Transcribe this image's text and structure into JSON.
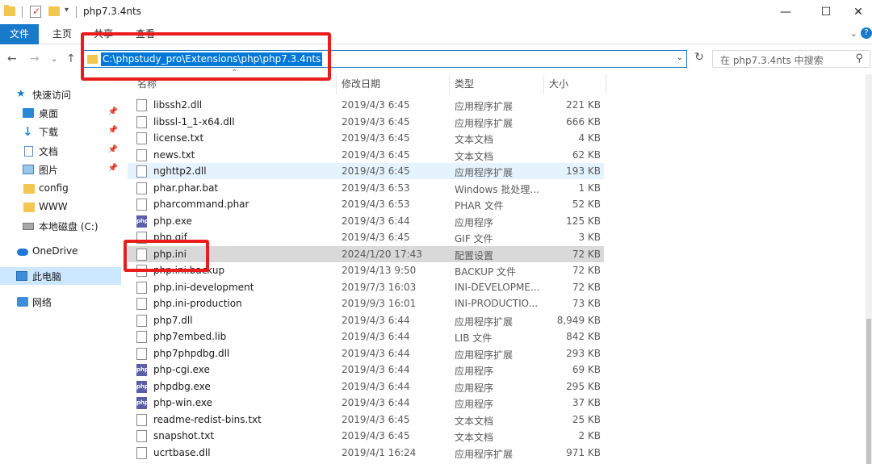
{
  "window": {
    "title": "php7.3.4nts",
    "quick_access_down": "▾"
  },
  "ribbon": {
    "tabs": [
      "文件",
      "主页",
      "共享",
      "查看"
    ]
  },
  "address": {
    "path": "C:\\phpstudy_pro\\Extensions\\php\\php7.3.4nts",
    "search_placeholder": "在 php7.3.4nts 中搜索"
  },
  "navpane": {
    "quick_access": "快速访问",
    "items": [
      {
        "label": "桌面",
        "icon": "desktop-icon",
        "pinned": true
      },
      {
        "label": "下载",
        "icon": "download-icon",
        "pinned": true
      },
      {
        "label": "文档",
        "icon": "document-icon",
        "pinned": true
      },
      {
        "label": "图片",
        "icon": "picture-icon",
        "pinned": true
      },
      {
        "label": "config",
        "icon": "folder-icon",
        "pinned": false
      },
      {
        "label": "WWW",
        "icon": "folder-icon",
        "pinned": false
      },
      {
        "label": "本地磁盘 (C:)",
        "icon": "drive-icon",
        "pinned": false
      }
    ],
    "onedrive": "OneDrive",
    "this_pc": "此电脑",
    "network": "网络"
  },
  "columns": {
    "name": "名称",
    "date": "修改日期",
    "type": "类型",
    "size": "大小"
  },
  "files": [
    {
      "name": "libssh2.dll",
      "date": "2019/4/3 6:45",
      "type": "应用程序扩展",
      "size": "221 KB",
      "icon": "dll"
    },
    {
      "name": "libssl-1_1-x64.dll",
      "date": "2019/4/3 6:45",
      "type": "应用程序扩展",
      "size": "666 KB",
      "icon": "dll"
    },
    {
      "name": "license.txt",
      "date": "2019/4/3 6:45",
      "type": "文本文档",
      "size": "4 KB",
      "icon": "txt"
    },
    {
      "name": "news.txt",
      "date": "2019/4/3 6:45",
      "type": "文本文档",
      "size": "62 KB",
      "icon": "txt"
    },
    {
      "name": "nghttp2.dll",
      "date": "2019/4/3 6:45",
      "type": "应用程序扩展",
      "size": "193 KB",
      "icon": "dll"
    },
    {
      "name": "phar.phar.bat",
      "date": "2019/4/3 6:53",
      "type": "Windows 批处理...",
      "size": "1 KB",
      "icon": "bat"
    },
    {
      "name": "pharcommand.phar",
      "date": "2019/4/3 6:53",
      "type": "PHAR 文件",
      "size": "52 KB",
      "icon": "file"
    },
    {
      "name": "php.exe",
      "date": "2019/4/3 6:44",
      "type": "应用程序",
      "size": "125 KB",
      "icon": "exe"
    },
    {
      "name": "php.gif",
      "date": "2019/4/3 6:45",
      "type": "GIF 文件",
      "size": "3 KB",
      "icon": "gif"
    },
    {
      "name": "php.ini",
      "date": "2024/1/20 17:43",
      "type": "配置设置",
      "size": "72 KB",
      "icon": "ini"
    },
    {
      "name": "php.ini.backup",
      "date": "2019/4/13 9:50",
      "type": "BACKUP 文件",
      "size": "72 KB",
      "icon": "file"
    },
    {
      "name": "php.ini-development",
      "date": "2019/7/3 16:03",
      "type": "INI-DEVELOPME...",
      "size": "72 KB",
      "icon": "file"
    },
    {
      "name": "php.ini-production",
      "date": "2019/9/3 16:01",
      "type": "INI-PRODUCTIO...",
      "size": "73 KB",
      "icon": "file"
    },
    {
      "name": "php7.dll",
      "date": "2019/4/3 6:44",
      "type": "应用程序扩展",
      "size": "8,949 KB",
      "icon": "dll"
    },
    {
      "name": "php7embed.lib",
      "date": "2019/4/3 6:44",
      "type": "LIB 文件",
      "size": "842 KB",
      "icon": "file"
    },
    {
      "name": "php7phpdbg.dll",
      "date": "2019/4/3 6:44",
      "type": "应用程序扩展",
      "size": "293 KB",
      "icon": "dll"
    },
    {
      "name": "php-cgi.exe",
      "date": "2019/4/3 6:44",
      "type": "应用程序",
      "size": "69 KB",
      "icon": "exe"
    },
    {
      "name": "phpdbg.exe",
      "date": "2019/4/3 6:44",
      "type": "应用程序",
      "size": "295 KB",
      "icon": "exe"
    },
    {
      "name": "php-win.exe",
      "date": "2019/4/3 6:44",
      "type": "应用程序",
      "size": "37 KB",
      "icon": "exe"
    },
    {
      "name": "readme-redist-bins.txt",
      "date": "2019/4/3 6:45",
      "type": "文本文档",
      "size": "25 KB",
      "icon": "txt"
    },
    {
      "name": "snapshot.txt",
      "date": "2019/4/3 6:45",
      "type": "文本文档",
      "size": "2 KB",
      "icon": "txt"
    },
    {
      "name": "ucrtbase.dll",
      "date": "2019/4/1 16:24",
      "type": "应用程序扩展",
      "size": "971 KB",
      "icon": "dll"
    }
  ],
  "exe_icon_text": "php",
  "colors": {
    "accent": "#1979ca",
    "selection": "#0078d7",
    "annotation": "#ea1d1d"
  }
}
